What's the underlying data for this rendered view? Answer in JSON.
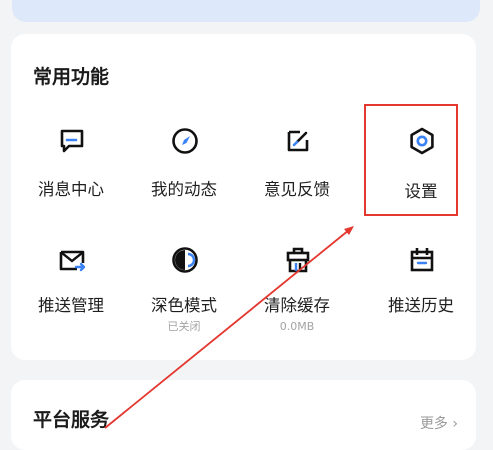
{
  "common": {
    "title": "常用功能",
    "items": [
      {
        "label": "消息中心",
        "sub": "",
        "icon": "message-center-icon"
      },
      {
        "label": "我的动态",
        "sub": "",
        "icon": "compass-icon"
      },
      {
        "label": "意见反馈",
        "sub": "",
        "icon": "feedback-edit-icon"
      },
      {
        "label": "设置",
        "sub": "",
        "icon": "settings-hexagon-icon"
      },
      {
        "label": "推送管理",
        "sub": "",
        "icon": "push-mail-icon"
      },
      {
        "label": "深色模式",
        "sub": "已关闭",
        "icon": "dark-mode-icon"
      },
      {
        "label": "清除缓存",
        "sub": "0.0MB",
        "icon": "clear-cache-icon"
      },
      {
        "label": "推送历史",
        "sub": "",
        "icon": "calendar-history-icon"
      }
    ]
  },
  "platform": {
    "title": "平台服务",
    "more": "更多"
  },
  "colors": {
    "icon_dark": "#111111",
    "icon_accent": "#3b82f6",
    "highlight": "#e3372f"
  }
}
